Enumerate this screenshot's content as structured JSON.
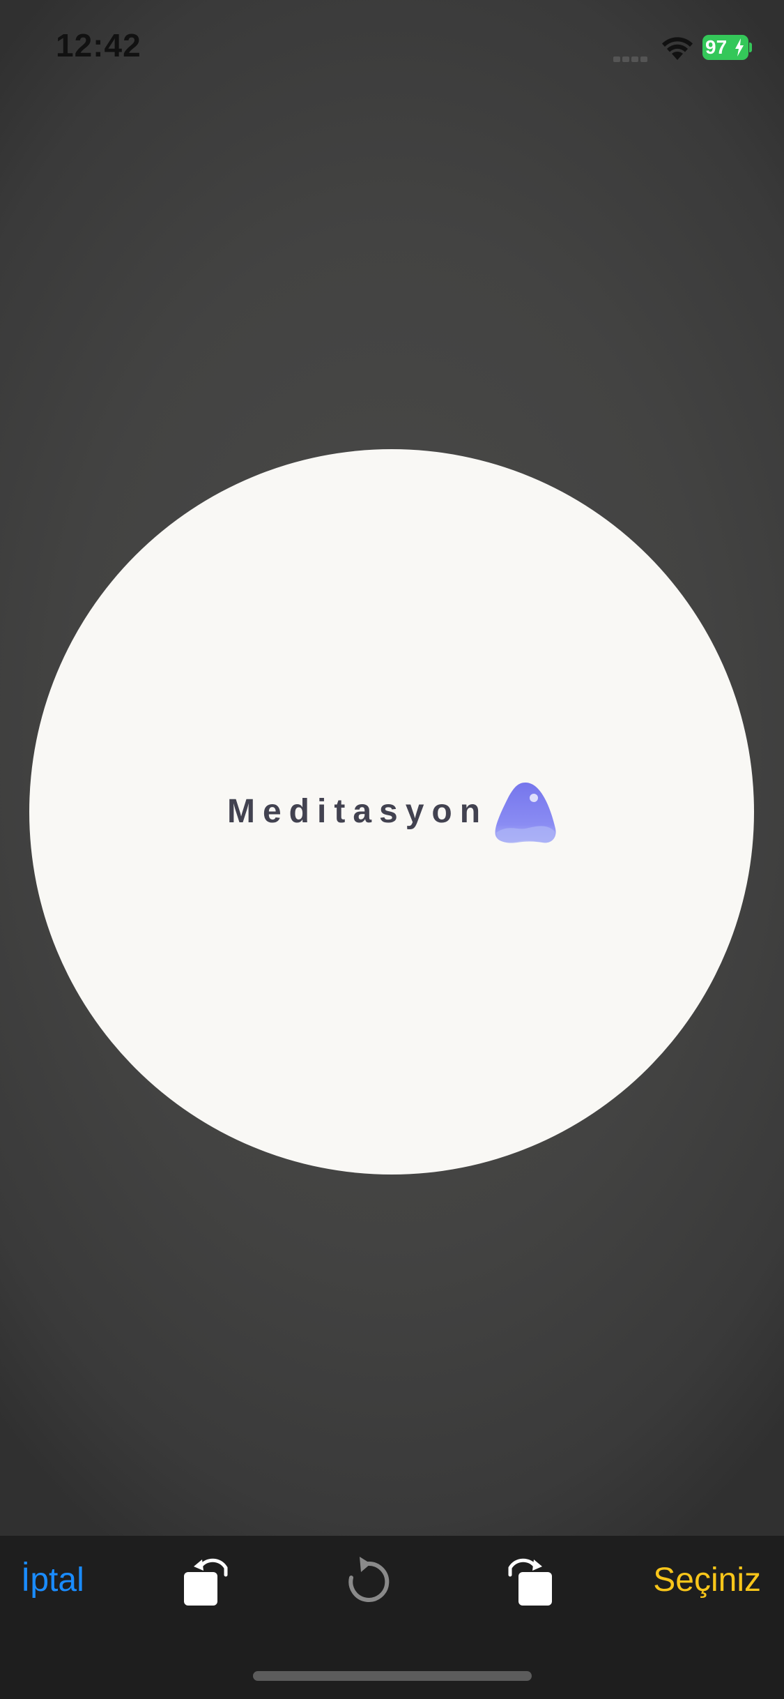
{
  "status_bar": {
    "time": "12:42",
    "battery_level": "97",
    "battery_charging": true,
    "icons": [
      "cellular-signal-icon",
      "wifi-icon",
      "battery-icon",
      "charging-bolt-icon"
    ]
  },
  "crop_area": {
    "shape": "circle",
    "logo_text": "Meditasyon",
    "logo_icon": "water-drop-logo"
  },
  "toolbar": {
    "cancel_label": "İptal",
    "choose_label": "Seçiniz",
    "icons": [
      "rotate-left-icon",
      "reset-rotation-icon",
      "rotate-right-icon"
    ]
  },
  "colors": {
    "accent_blue": "#1a8cff",
    "accent_yellow": "#f9c61a",
    "battery_green": "#34c759",
    "logo_purple": "#7b7cf0"
  }
}
